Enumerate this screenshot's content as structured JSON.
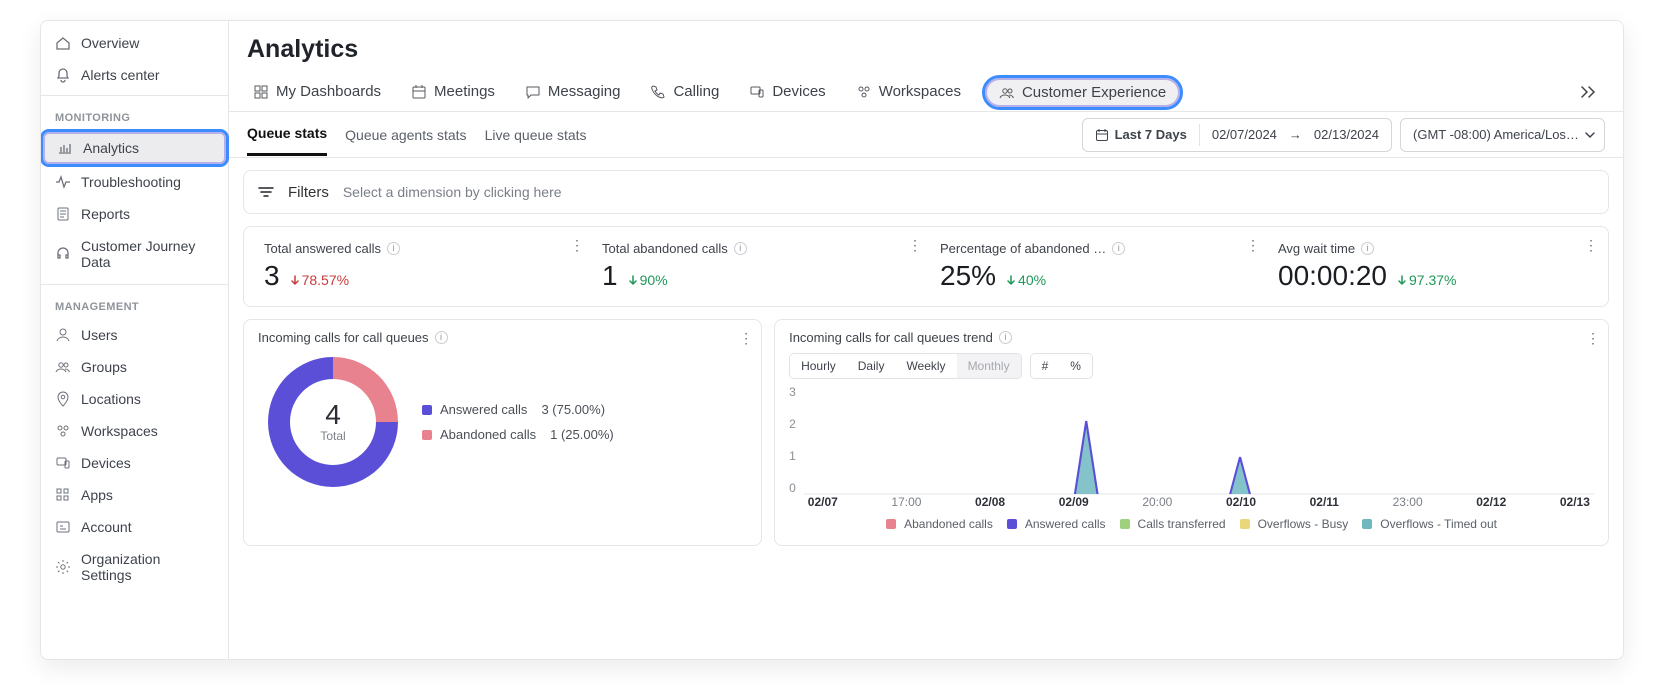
{
  "sidebar": {
    "top_items": [
      {
        "label": "Overview",
        "icon": "home"
      },
      {
        "label": "Alerts center",
        "icon": "bell"
      }
    ],
    "sections": [
      {
        "label": "MONITORING",
        "items": [
          {
            "label": "Analytics",
            "icon": "chart",
            "active": true
          },
          {
            "label": "Troubleshooting",
            "icon": "activity"
          },
          {
            "label": "Reports",
            "icon": "doc"
          },
          {
            "label": "Customer Journey Data",
            "icon": "headset"
          }
        ]
      },
      {
        "label": "MANAGEMENT",
        "items": [
          {
            "label": "Users",
            "icon": "user"
          },
          {
            "label": "Groups",
            "icon": "users"
          },
          {
            "label": "Locations",
            "icon": "pin"
          },
          {
            "label": "Workspaces",
            "icon": "workspaces"
          },
          {
            "label": "Devices",
            "icon": "devices"
          },
          {
            "label": "Apps",
            "icon": "apps"
          },
          {
            "label": "Account",
            "icon": "account"
          },
          {
            "label": "Organization Settings",
            "icon": "gear"
          }
        ]
      }
    ]
  },
  "page_title": "Analytics",
  "tabs": [
    {
      "label": "My Dashboards",
      "icon": "grid"
    },
    {
      "label": "Meetings",
      "icon": "calendar"
    },
    {
      "label": "Messaging",
      "icon": "chat"
    },
    {
      "label": "Calling",
      "icon": "phone"
    },
    {
      "label": "Devices",
      "icon": "devices"
    },
    {
      "label": "Workspaces",
      "icon": "workspaces"
    },
    {
      "label": "Customer Experience",
      "icon": "users",
      "active": true
    }
  ],
  "subtabs": [
    {
      "label": "Queue stats",
      "current": true
    },
    {
      "label": "Queue agents stats"
    },
    {
      "label": "Live queue stats"
    }
  ],
  "date": {
    "range_label": "Last 7 Days",
    "start": "02/07/2024",
    "end": "02/13/2024"
  },
  "timezone_label": "(GMT -08:00) America/Los …",
  "filters": {
    "title": "Filters",
    "placeholder": "Select a dimension by clicking here"
  },
  "kpis": [
    {
      "label": "Total answered calls",
      "value": "3",
      "delta": "78.57%",
      "dir": "down",
      "color": "red"
    },
    {
      "label": "Total abandoned calls",
      "value": "1",
      "delta": "90%",
      "dir": "down",
      "color": "green"
    },
    {
      "label": "Percentage of abandoned …",
      "value": "25%",
      "delta": "40%",
      "dir": "down",
      "color": "green"
    },
    {
      "label": "Avg wait time",
      "value": "00:00:20",
      "delta": "97.37%",
      "dir": "down",
      "color": "green"
    }
  ],
  "donut_card": {
    "title": "Incoming calls for call queues",
    "total_value": "4",
    "total_label": "Total",
    "legend": [
      {
        "label": "Answered calls",
        "value": "3 (75.00%)",
        "color": "#5b4fd8"
      },
      {
        "label": "Abandoned calls",
        "value": "1 (25.00%)",
        "color": "#e7828e"
      }
    ]
  },
  "trend_card": {
    "title": "Incoming calls for call queues trend",
    "granularities": [
      {
        "label": "Hourly",
        "sel": true
      },
      {
        "label": "Daily"
      },
      {
        "label": "Weekly"
      },
      {
        "label": "Monthly",
        "off": true
      }
    ],
    "modes": [
      {
        "label": "#",
        "sel": true
      },
      {
        "label": "%"
      }
    ],
    "y_ticks": [
      "3",
      "2",
      "1",
      "0"
    ],
    "x_ticks": [
      {
        "label": "02/07",
        "bold": true
      },
      {
        "label": "17:00"
      },
      {
        "label": "02/08",
        "bold": true
      },
      {
        "label": "02/09",
        "bold": true
      },
      {
        "label": "20:00"
      },
      {
        "label": "02/10",
        "bold": true
      },
      {
        "label": "02/11",
        "bold": true
      },
      {
        "label": "23:00"
      },
      {
        "label": "02/12",
        "bold": true
      },
      {
        "label": "02/13",
        "bold": true
      }
    ],
    "legend": [
      {
        "label": "Abandoned calls",
        "color": "#e7828e"
      },
      {
        "label": "Answered calls",
        "color": "#5b4fd8"
      },
      {
        "label": "Calls transferred",
        "color": "#9fd07e"
      },
      {
        "label": "Overflows - Busy",
        "color": "#e9d77a"
      },
      {
        "label": "Overflows - Timed out",
        "color": "#6fb8bf"
      }
    ]
  },
  "chart_data": [
    {
      "type": "pie",
      "title": "Incoming calls for call queues",
      "series": [
        {
          "name": "Answered calls",
          "value": 3,
          "percent": 75.0
        },
        {
          "name": "Abandoned calls",
          "value": 1,
          "percent": 25.0
        }
      ],
      "total": 4
    },
    {
      "type": "area",
      "title": "Incoming calls for call queues trend",
      "x_range": [
        "02/07",
        "02/13"
      ],
      "granularity": "Hourly",
      "yaxis": {
        "min": 0,
        "max": 3,
        "ticks": [
          0,
          1,
          2,
          3
        ]
      },
      "series": [
        {
          "name": "Answered calls",
          "color": "#5b4fd8",
          "peaks": [
            {
              "x": "02/09",
              "value": 2
            },
            {
              "x": "02/10",
              "value": 1
            }
          ]
        },
        {
          "name": "Overflows - Timed out",
          "color": "#6fb8bf",
          "peaks": [
            {
              "x": "02/09",
              "value": 2
            },
            {
              "x": "02/10",
              "value": 1
            }
          ]
        },
        {
          "name": "Abandoned calls",
          "color": "#e7828e",
          "peaks": []
        },
        {
          "name": "Calls transferred",
          "color": "#9fd07e",
          "peaks": []
        },
        {
          "name": "Overflows - Busy",
          "color": "#e9d77a",
          "peaks": []
        }
      ]
    }
  ]
}
